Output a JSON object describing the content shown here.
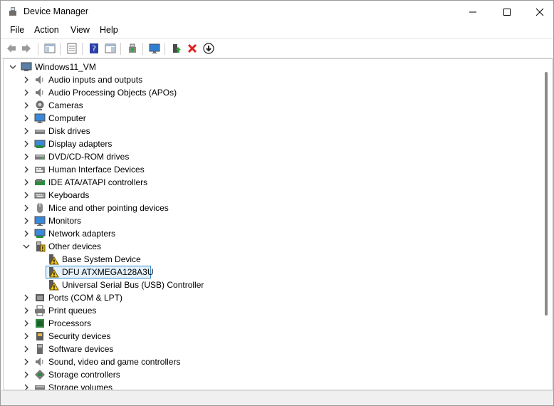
{
  "window": {
    "title": "Device Manager"
  },
  "menu": {
    "file": "File",
    "action": "Action",
    "view": "View",
    "help": "Help"
  },
  "tree": {
    "root": "Windows11_VM",
    "categories": [
      {
        "label": "Audio inputs and outputs",
        "icon": "speaker-icon"
      },
      {
        "label": "Audio Processing Objects (APOs)",
        "icon": "speaker-icon"
      },
      {
        "label": "Cameras",
        "icon": "camera-icon"
      },
      {
        "label": "Computer",
        "icon": "monitor-icon"
      },
      {
        "label": "Disk drives",
        "icon": "disk-drive-icon"
      },
      {
        "label": "Display adapters",
        "icon": "display-adapter-icon"
      },
      {
        "label": "DVD/CD-ROM drives",
        "icon": "dvd-drive-icon"
      },
      {
        "label": "Human Interface Devices",
        "icon": "hid-icon"
      },
      {
        "label": "IDE ATA/ATAPI controllers",
        "icon": "ide-controller-icon"
      },
      {
        "label": "Keyboards",
        "icon": "keyboard-icon"
      },
      {
        "label": "Mice and other pointing devices",
        "icon": "mouse-icon"
      },
      {
        "label": "Monitors",
        "icon": "monitor-icon"
      },
      {
        "label": "Network adapters",
        "icon": "network-adapter-icon"
      }
    ],
    "other_devices": {
      "label": "Other devices",
      "children": [
        {
          "label": "Base System Device"
        },
        {
          "label": "DFU ATXMEGA128A3U"
        },
        {
          "label": "Universal Serial Bus (USB) Controller"
        }
      ]
    },
    "categories_after": [
      {
        "label": "Ports (COM & LPT)",
        "icon": "port-icon"
      },
      {
        "label": "Print queues",
        "icon": "printer-icon"
      },
      {
        "label": "Processors",
        "icon": "processor-icon"
      },
      {
        "label": "Security devices",
        "icon": "security-icon"
      },
      {
        "label": "Software devices",
        "icon": "software-device-icon"
      },
      {
        "label": "Sound, video and game controllers",
        "icon": "speaker-icon"
      },
      {
        "label": "Storage controllers",
        "icon": "storage-controller-icon"
      },
      {
        "label": "Storage volumes",
        "icon": "storage-volume-icon"
      }
    ]
  }
}
